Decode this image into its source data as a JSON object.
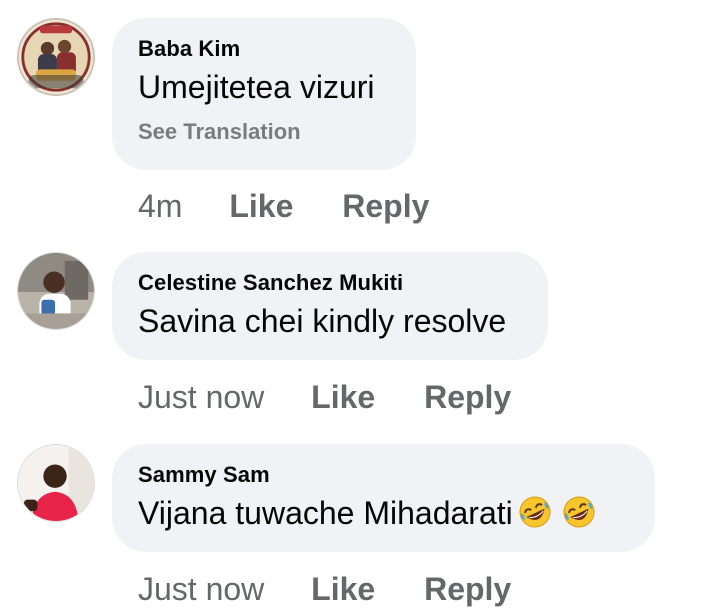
{
  "comments": [
    {
      "author": "Baba Kim",
      "text": "Umejitetea vizuri",
      "translate": "See Translation",
      "time": "4m",
      "like": "Like",
      "reply": "Reply"
    },
    {
      "author": "Celestine Sanchez Mukiti",
      "text": "Savina chei kindly resolve",
      "time": "Just now",
      "like": "Like",
      "reply": "Reply"
    },
    {
      "author": "Sammy Sam",
      "text": "Vijana tuwache Mihadarati",
      "emojis": [
        "rolling-on-floor-laughing",
        "rolling-on-floor-laughing"
      ],
      "time": "Just now",
      "like": "Like",
      "reply": "Reply"
    }
  ],
  "colors": {
    "bubble": "#f0f2f5",
    "name_text": "#050505",
    "meta_text": "#65676b",
    "translate_text": "#7a7c80"
  }
}
